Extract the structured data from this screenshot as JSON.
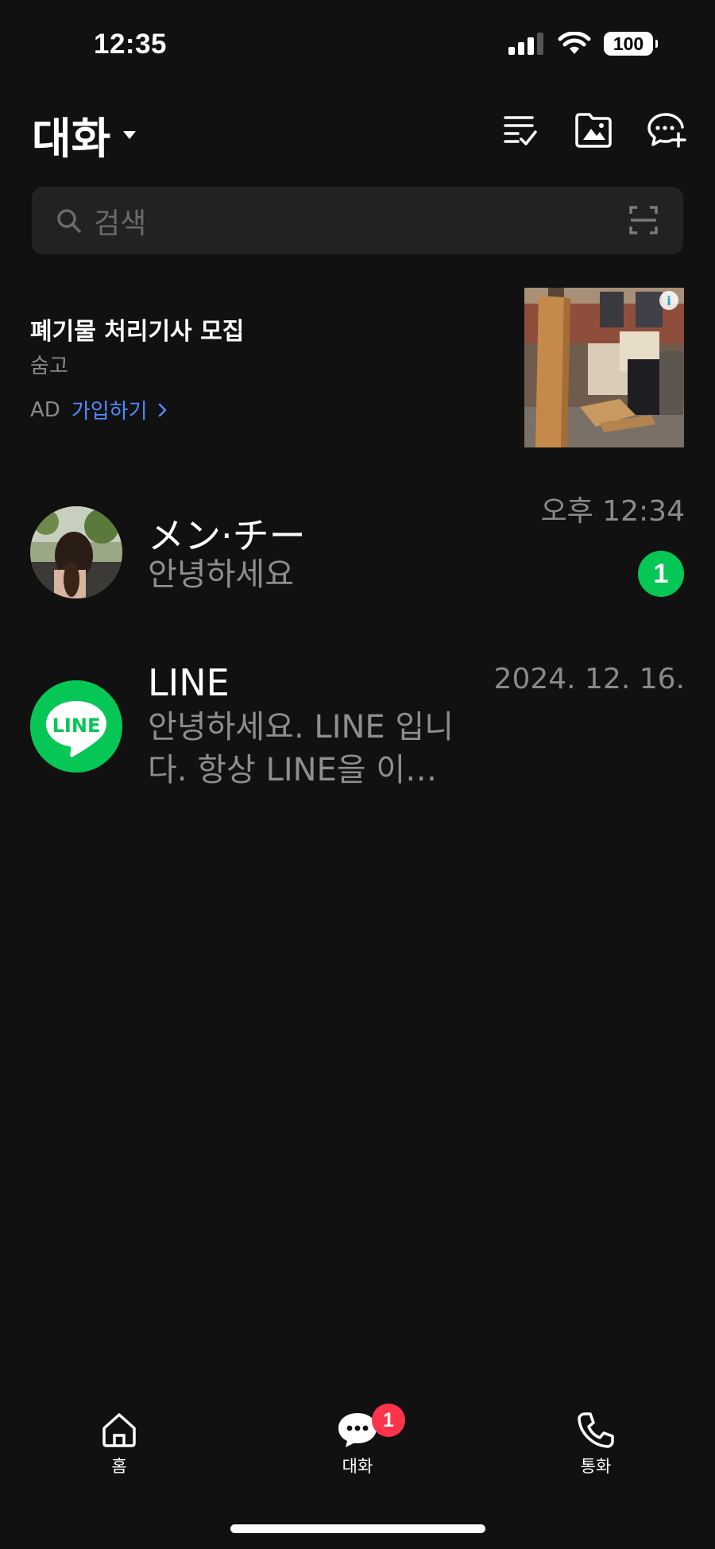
{
  "status_bar": {
    "time": "12:35",
    "battery": "100"
  },
  "header": {
    "title": "대화"
  },
  "search": {
    "placeholder": "검색"
  },
  "ad": {
    "title": "폐기물 처리기사 모집",
    "advertiser": "숨고",
    "label": "AD",
    "cta": "가입하기"
  },
  "chats": [
    {
      "name": "メン·チー",
      "message": "안녕하세요",
      "time": "오후 12:34",
      "unread": "1"
    },
    {
      "name": "LINE",
      "message_line1": "안녕하세요. LINE 입니",
      "message_line2": "다. 항상 LINE을 이…",
      "time": "2024. 12. 16.",
      "logo_text": "LINE"
    }
  ],
  "nav": {
    "home": "홈",
    "chats": "대화",
    "chats_badge": "1",
    "calls": "통화"
  },
  "colors": {
    "background": "#111111",
    "line_green": "#06c755",
    "badge_red": "#ff334b",
    "link_blue": "#4f8cff"
  }
}
